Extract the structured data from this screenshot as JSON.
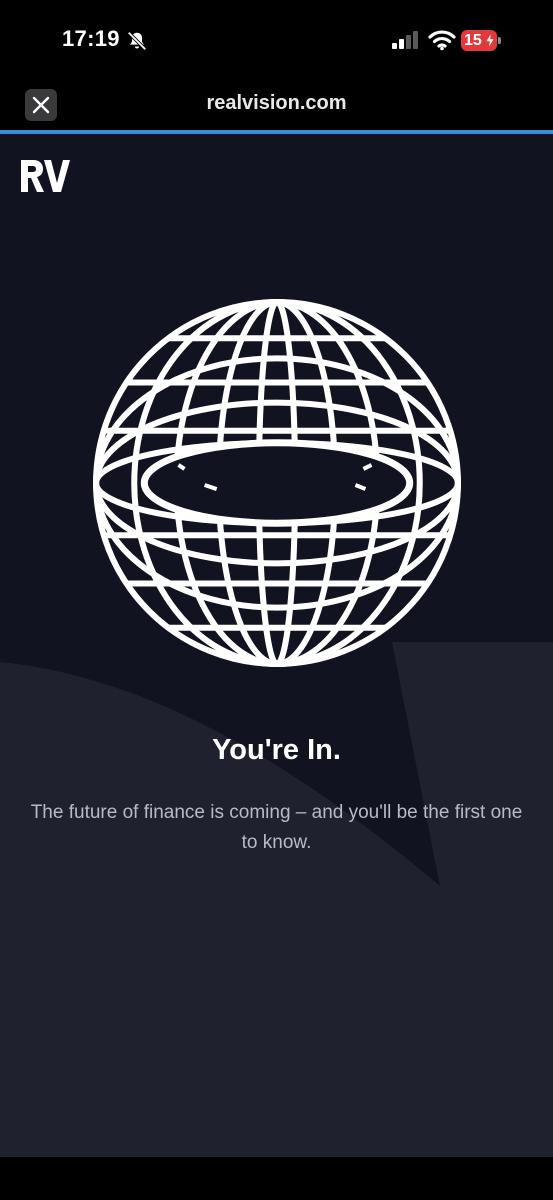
{
  "status_bar": {
    "time": "17:19",
    "battery_level": "15",
    "icons": [
      "bell-off-icon",
      "signal-icon",
      "wifi-icon",
      "battery-charging-icon"
    ]
  },
  "browser": {
    "url": "realvision.com",
    "close_icon": "close-icon",
    "accent_color": "#3b8ce0"
  },
  "page": {
    "logo_text": "RV",
    "hero_graphic": "globe-wireframe",
    "headline": "You're In.",
    "subtext": "The future of finance is coming – and you'll be the first one to know.",
    "colors": {
      "background": "#121320",
      "accent_shape": "#20212e",
      "headline": "#ffffff",
      "subtext": "#b8bac6"
    }
  }
}
